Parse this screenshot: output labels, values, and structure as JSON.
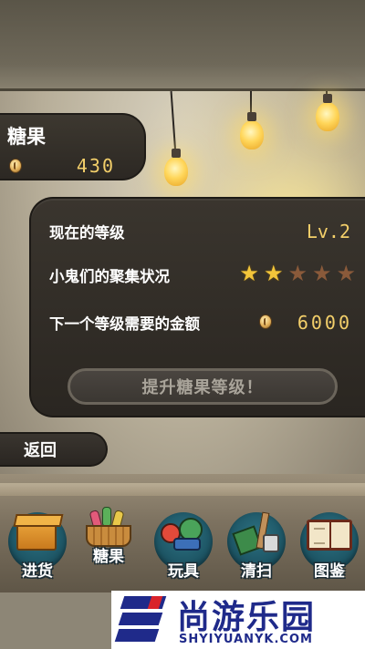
{
  "candy": {
    "title": "糖果",
    "count": "430"
  },
  "level_panel": {
    "current_level_label": "现在的等级",
    "current_level_value": "Lv.2",
    "gathering_label": "小鬼们的聚集状况",
    "stars_filled": 2,
    "stars_total": 5,
    "next_level_gold_label": "下一个等级需要的金额",
    "next_level_gold_value": "6000",
    "upgrade_button": "提升糖果等级！"
  },
  "back_button": "返回",
  "menu": [
    {
      "label": "进货",
      "icon": "cardboard-box-icon"
    },
    {
      "label": "糖果",
      "icon": "candy-basket-icon",
      "active": true
    },
    {
      "label": "玩具",
      "icon": "toys-icon"
    },
    {
      "label": "清扫",
      "icon": "cleaning-supplies-icon"
    },
    {
      "label": "图鉴",
      "icon": "open-book-icon"
    }
  ],
  "watermark": {
    "title": "尚游乐园",
    "url": "SHYIYUANYK.COM"
  },
  "colors": {
    "gold_text": "#f3cf6a",
    "panel_bg": "#2c2823",
    "menu_circle": "#1b5160",
    "star_on": "#f2c53a",
    "star_off": "#8a5a3a"
  }
}
